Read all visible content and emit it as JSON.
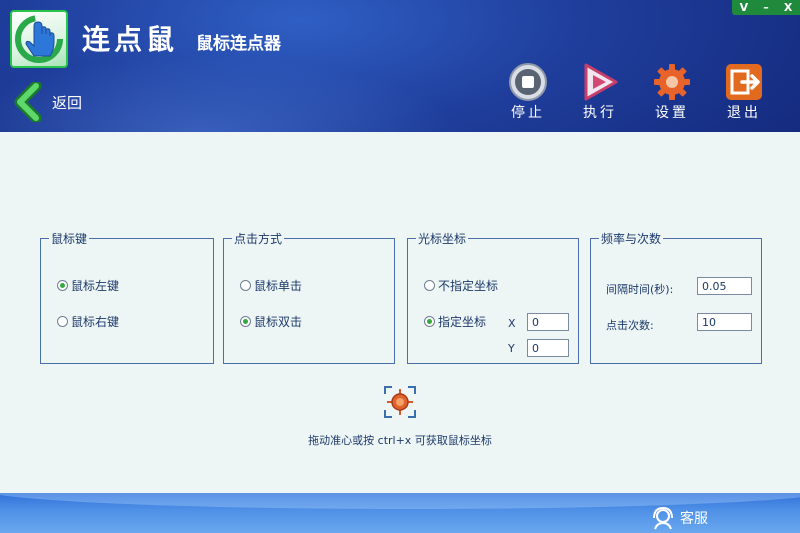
{
  "window_controls": {
    "minimize_alt": "V",
    "minimize": "–",
    "close": "X"
  },
  "header": {
    "title_main": "连点鼠",
    "title_sub": "鼠标连点器",
    "back_label": "返回"
  },
  "toolbar": {
    "stop_label": "停止",
    "run_label": "执行",
    "settings_label": "设置",
    "exit_label": "退出"
  },
  "mouse_button": {
    "legend": "鼠标键",
    "left_label": "鼠标左键",
    "right_label": "鼠标右键",
    "selected": "left"
  },
  "click_mode": {
    "legend": "点击方式",
    "single_label": "鼠标单击",
    "double_label": "鼠标双击",
    "selected": "double"
  },
  "cursor_coords": {
    "legend": "光标坐标",
    "unspecified_label": "不指定坐标",
    "specified_label": "指定坐标",
    "x_label": "X",
    "y_label": "Y",
    "x_value": "0",
    "y_value": "0",
    "selected": "specified"
  },
  "frequency": {
    "legend": "频率与次数",
    "interval_label": "间隔时间(秒):",
    "interval_value": "0.05",
    "count_label": "点击次数:",
    "count_value": "10"
  },
  "hint": "拖动准心或按 ctrl+x 可获取鼠标坐标",
  "footer": {
    "support_label": "客服"
  },
  "colors": {
    "header_bg": "#1f3e9c",
    "accent_green": "#35a83f",
    "label_text": "#1c3a6a",
    "footer_bg": "#4d8fe6"
  },
  "icons": {
    "logo": "hand-cursor-icon",
    "back": "chevron-left-icon",
    "stop": "stop-icon",
    "run": "play-icon",
    "settings": "gear-icon",
    "exit": "exit-icon",
    "crosshair": "crosshair-icon",
    "support": "headset-icon"
  }
}
